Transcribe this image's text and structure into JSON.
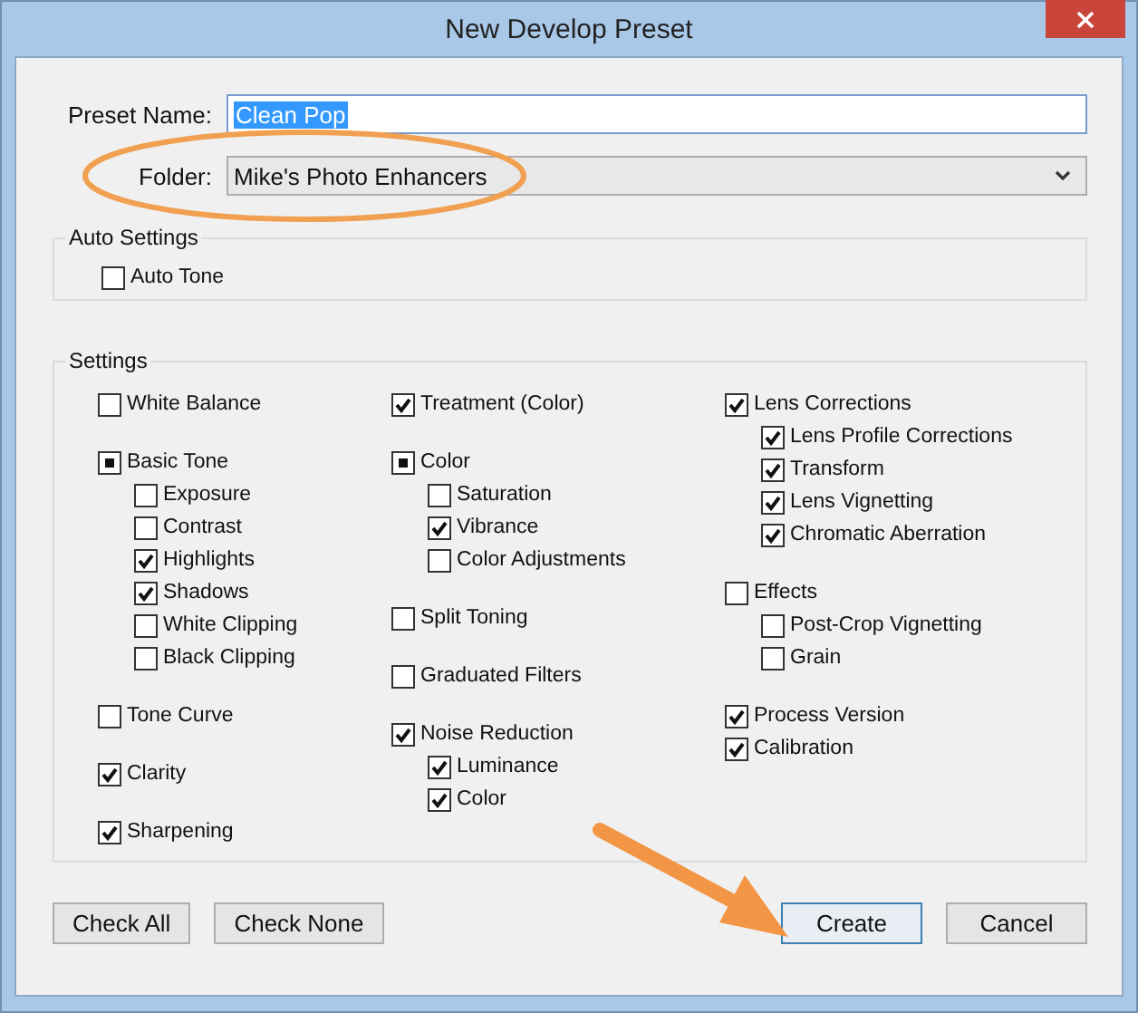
{
  "window": {
    "title": "New Develop Preset"
  },
  "preset_name": {
    "label": "Preset Name:",
    "value": "Clean Pop",
    "value_selected": true
  },
  "folder": {
    "label": "Folder:",
    "value": "Mike's Photo Enhancers"
  },
  "auto_settings": {
    "title": "Auto Settings",
    "items": [
      {
        "label": "Auto Tone",
        "checked": false
      }
    ]
  },
  "settings": {
    "title": "Settings",
    "columns": [
      [
        [
          {
            "label": "White Balance",
            "checked": false
          }
        ],
        [
          {
            "label": "Basic Tone",
            "checked": true,
            "indeterminate": true,
            "children": [
              {
                "label": "Exposure",
                "checked": false
              },
              {
                "label": "Contrast",
                "checked": false
              },
              {
                "label": "Highlights",
                "checked": true
              },
              {
                "label": "Shadows",
                "checked": true
              },
              {
                "label": "White Clipping",
                "checked": false
              },
              {
                "label": "Black Clipping",
                "checked": false
              }
            ]
          }
        ],
        [
          {
            "label": "Tone Curve",
            "checked": false
          }
        ],
        [
          {
            "label": "Clarity",
            "checked": true
          }
        ],
        [
          {
            "label": "Sharpening",
            "checked": true
          }
        ]
      ],
      [
        [
          {
            "label": "Treatment (Color)",
            "checked": true
          }
        ],
        [
          {
            "label": "Color",
            "checked": true,
            "indeterminate": true,
            "children": [
              {
                "label": "Saturation",
                "checked": false
              },
              {
                "label": "Vibrance",
                "checked": true
              },
              {
                "label": "Color Adjustments",
                "checked": false
              }
            ]
          }
        ],
        [
          {
            "label": "Split Toning",
            "checked": false
          }
        ],
        [
          {
            "label": "Graduated Filters",
            "checked": false
          }
        ],
        [
          {
            "label": "Noise Reduction",
            "checked": true,
            "children": [
              {
                "label": "Luminance",
                "checked": true
              },
              {
                "label": "Color",
                "checked": true
              }
            ]
          }
        ]
      ],
      [
        [
          {
            "label": "Lens Corrections",
            "checked": true,
            "children": [
              {
                "label": "Lens Profile Corrections",
                "checked": true
              },
              {
                "label": "Transform",
                "checked": true
              },
              {
                "label": "Lens Vignetting",
                "checked": true
              },
              {
                "label": "Chromatic Aberration",
                "checked": true
              }
            ]
          }
        ],
        [
          {
            "label": "Effects",
            "checked": false,
            "children": [
              {
                "label": "Post-Crop Vignetting",
                "checked": false
              },
              {
                "label": "Grain",
                "checked": false
              }
            ]
          }
        ],
        [
          {
            "label": "Process Version",
            "checked": true
          },
          {
            "label": "Calibration",
            "checked": true
          }
        ]
      ]
    ]
  },
  "buttons": [
    {
      "label": "Check All",
      "default": false
    },
    {
      "label": "Check None",
      "default": false
    },
    {
      "label": "Create",
      "default": true
    },
    {
      "label": "Cancel",
      "default": false
    }
  ]
}
